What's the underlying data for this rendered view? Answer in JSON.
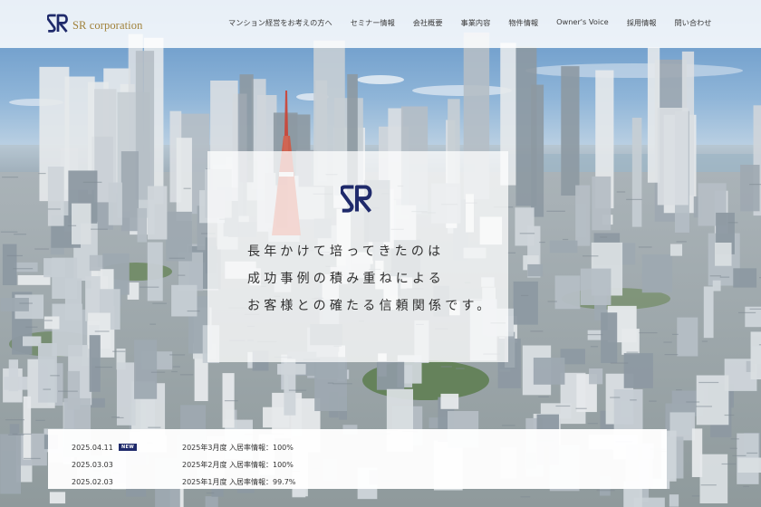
{
  "brand": {
    "name": "SR corporation",
    "logo_text": "SR",
    "logo_color": "#1f2a6b",
    "accent_color": "#a0813a"
  },
  "nav": {
    "items": [
      {
        "label": "マンション経営をお考えの方へ"
      },
      {
        "label": "セミナー情報"
      },
      {
        "label": "会社概要"
      },
      {
        "label": "事業内容"
      },
      {
        "label": "物件情報"
      },
      {
        "label": "Owner's Voice"
      },
      {
        "label": "採用情報"
      },
      {
        "label": "問い合わせ"
      }
    ]
  },
  "hero": {
    "tagline": [
      "長年かけて培ってきたのは",
      "成功事例の積み重ねによる",
      "お客様との確たる信頼関係です。"
    ]
  },
  "news": {
    "items": [
      {
        "date": "2025.04.11",
        "badge": "NEW",
        "title": "2025年3月度 入居率情報：100%"
      },
      {
        "date": "2025.03.03",
        "badge": "",
        "title": "2025年2月度 入居率情報：100%"
      },
      {
        "date": "2025.02.03",
        "badge": "",
        "title": "2025年1月度 入居率情報：99.7%"
      }
    ]
  }
}
